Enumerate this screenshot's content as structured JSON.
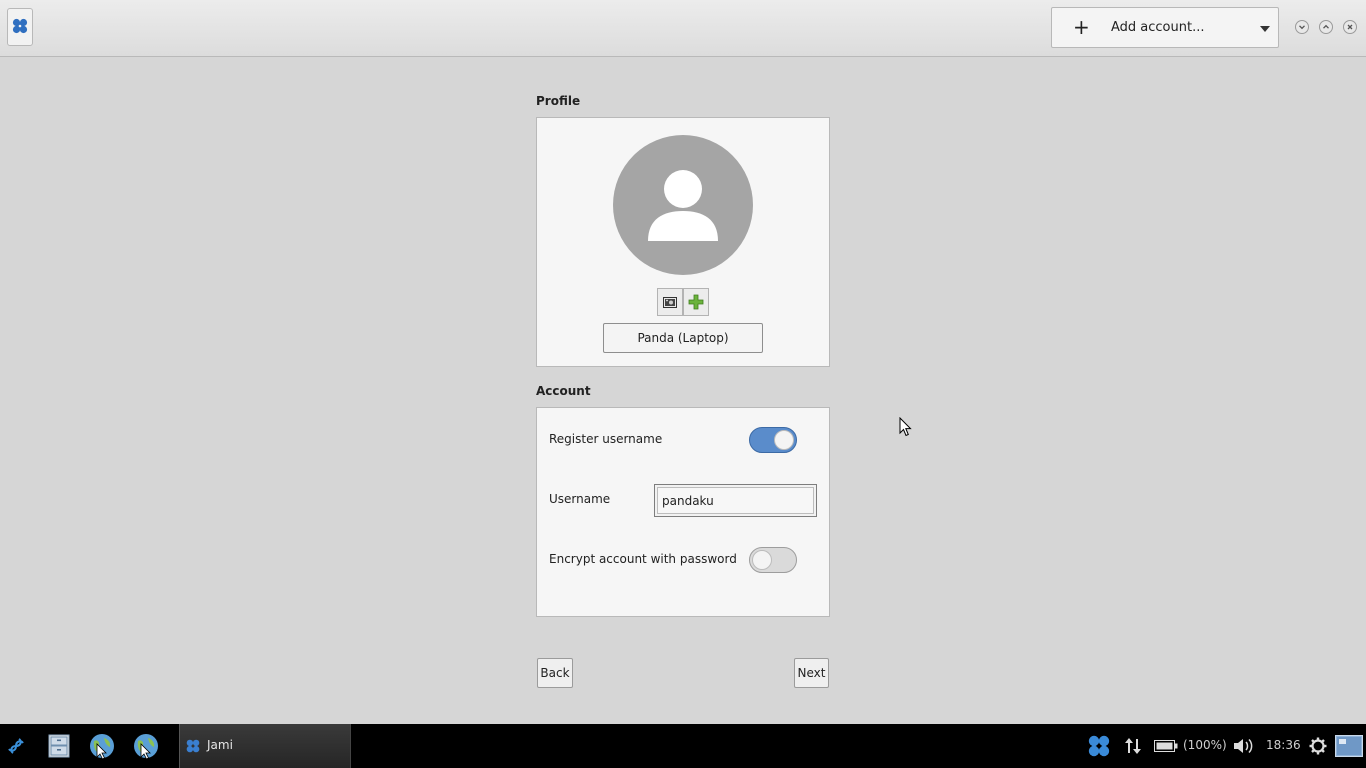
{
  "header": {
    "app_icon": "jami-logo-icon",
    "add_account_label": "Add account...",
    "window_buttons": [
      "minimize-icon",
      "maximize-icon",
      "close-icon"
    ]
  },
  "profile": {
    "section_title": "Profile",
    "avatar_icon": "user-silhouette-icon",
    "take_photo_icon": "camera-icon",
    "choose_image_icon": "plus-icon",
    "display_name": "Panda (Laptop)"
  },
  "account": {
    "section_title": "Account",
    "register_username_label": "Register username",
    "register_username_on": true,
    "username_label": "Username",
    "username_value": "pandaku",
    "encrypt_label": "Encrypt account with password",
    "encrypt_on": false
  },
  "nav": {
    "back_label": "Back",
    "next_label": "Next"
  },
  "taskbar": {
    "task_label": "Jami",
    "battery_text": "(100%)",
    "clock": "18:36"
  },
  "colors": {
    "accent": "#5a8ccb",
    "jami_blue": "#2f6fc0",
    "add_green": "#6bb33c"
  }
}
